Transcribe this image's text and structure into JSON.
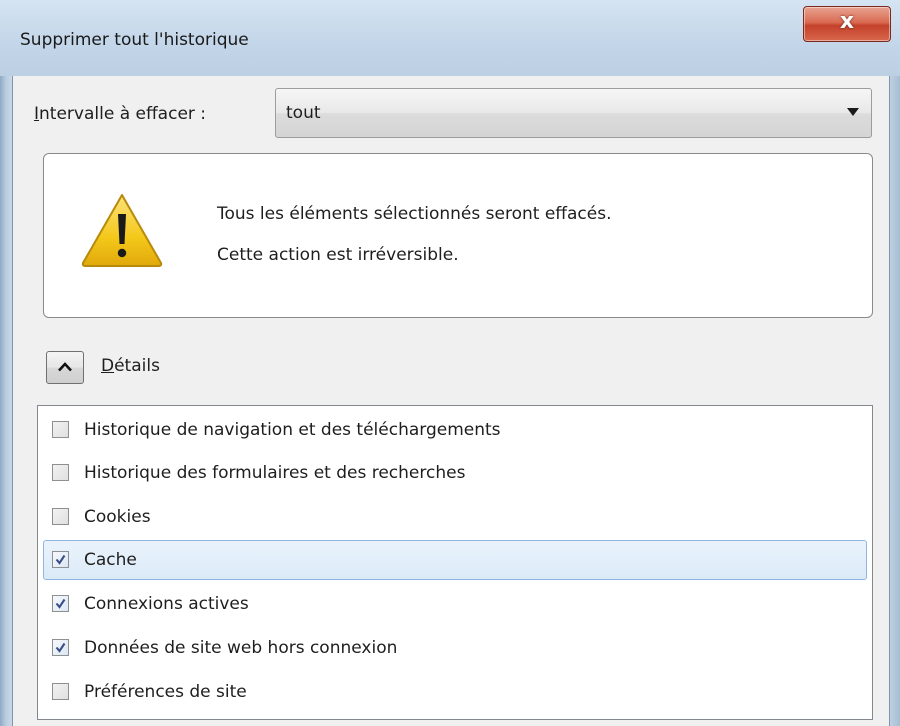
{
  "window": {
    "title": "Supprimer tout l'historique",
    "close_label": "x"
  },
  "range": {
    "label_prefix": "I",
    "label_rest": "ntervalle à effacer :",
    "value": "tout"
  },
  "warning": {
    "line1": "Tous les éléments sélectionnés seront effacés.",
    "line2": "Cette action est irréversible."
  },
  "details": {
    "label_prefix": "D",
    "label_rest": "étails",
    "expanded": true
  },
  "items": [
    {
      "label": "Historique de navigation et des téléchargements",
      "checked": false,
      "selected": false
    },
    {
      "label": "Historique des formulaires et des recherches",
      "checked": false,
      "selected": false
    },
    {
      "label": "Cookies",
      "checked": false,
      "selected": false
    },
    {
      "label": "Cache",
      "checked": true,
      "selected": true
    },
    {
      "label": "Connexions actives",
      "checked": true,
      "selected": false
    },
    {
      "label": "Données de site web hors connexion",
      "checked": true,
      "selected": false
    },
    {
      "label": "Préférences de site",
      "checked": false,
      "selected": false
    }
  ],
  "colors": {
    "selection_border": "#8fb6e0",
    "close_button": "#c4412a",
    "warning_yellow": "#f4c81a"
  }
}
